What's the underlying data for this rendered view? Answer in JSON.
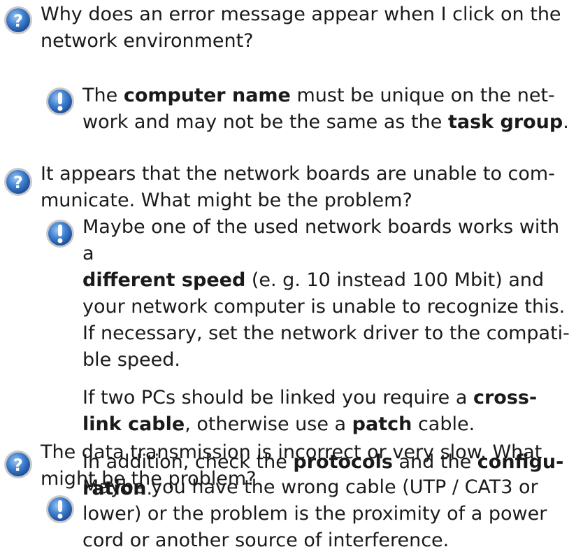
{
  "icons": {
    "question": "question-icon",
    "info": "exclamation-info-icon",
    "question_color": "#2f6fc0",
    "info_color": "#2f6fc0"
  },
  "faq": [
    {
      "question": {
        "line1": "Why does an error message appear when I click on the",
        "line2": "network environment?"
      },
      "answer": {
        "p1": {
          "t1": "The ",
          "b1": "computer name",
          "t2": " must be unique on the net-",
          "t3": "work and may not be the same as the ",
          "b2": "task group",
          "t4": "."
        }
      }
    },
    {
      "question": {
        "line1": "It appears that the network boards are unable to com-",
        "line2": "municate. What might be the problem?"
      },
      "answer": {
        "p1": {
          "t1": "Maybe one of the used network boards works with a",
          "b1": "different speed",
          "t2": " (e. g. 10 instead 100 Mbit) and",
          "t3": "your network computer is unable to recognize this.",
          "t4": "If necessary, set the network driver to the compati-",
          "t5": "ble speed."
        },
        "p2": {
          "t1": "If two PCs should be linked you require a ",
          "b1": "cross-",
          "b2": "link cable",
          "t2": ", otherwise use a ",
          "b3": "patch",
          "t3": " cable."
        },
        "p3": {
          "t1": "In addition, check the ",
          "b1": "protocols",
          "t2": " and the ",
          "b2": "configu-",
          "b3": "ration",
          "t3": "."
        }
      }
    },
    {
      "question": {
        "line1": "The data transmission is incorrect or very slow. What",
        "line2": "might be the problem?"
      },
      "answer": {
        "p1": {
          "t1": "Maybe you have the wrong cable (UTP / CAT3 or",
          "t2": "lower) or the problem is the proximity of a power",
          "t3": "cord or another source of interference."
        }
      }
    }
  ]
}
